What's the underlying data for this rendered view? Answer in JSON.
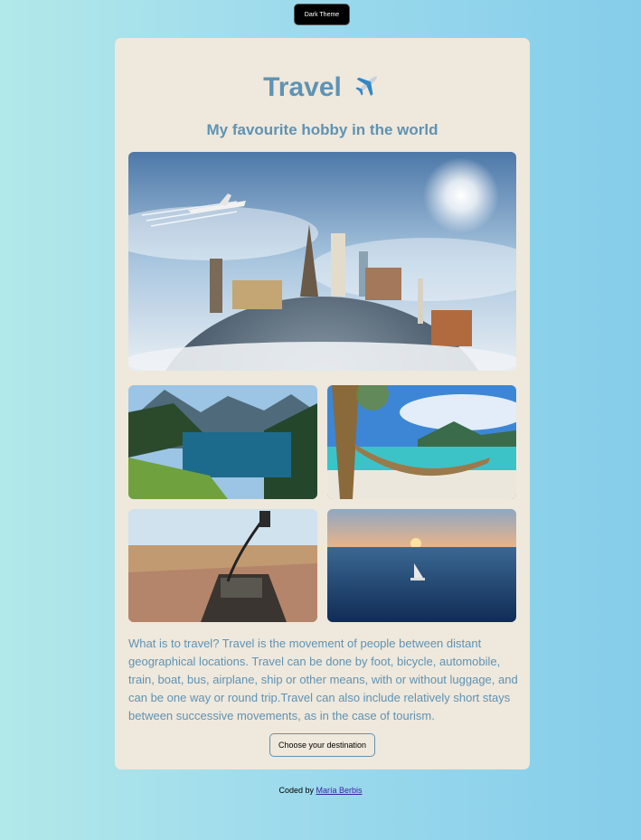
{
  "header": {
    "theme_button_label": "Dark Theme"
  },
  "card": {
    "title": "Travel",
    "title_icon": "airplane-icon",
    "subtitle": "My favourite hobby in the world",
    "images": {
      "hero": "world-landmarks-globe-photo",
      "grid": [
        "mountain-lake-photo",
        "beach-hammock-photo",
        "helicopter-cockpit-photo",
        "sunset-sailboat-photo"
      ]
    },
    "description": "What is to travel? Travel is the movement of people between distant geographical locations. Travel can be done by foot, bicycle, automobile, train, boat, bus, airplane, ship or other means, with or without luggage, and can be one way or round trip.Travel can also include relatively short stays between successive movements, as in the case of tourism.",
    "cta_label": "Choose your destination"
  },
  "footer": {
    "prefix": "Coded by",
    "author": "María Berbis"
  },
  "colors": {
    "accent": "#5e93b4",
    "card_bg": "#efe8dc",
    "link": "#3b1ea8"
  }
}
